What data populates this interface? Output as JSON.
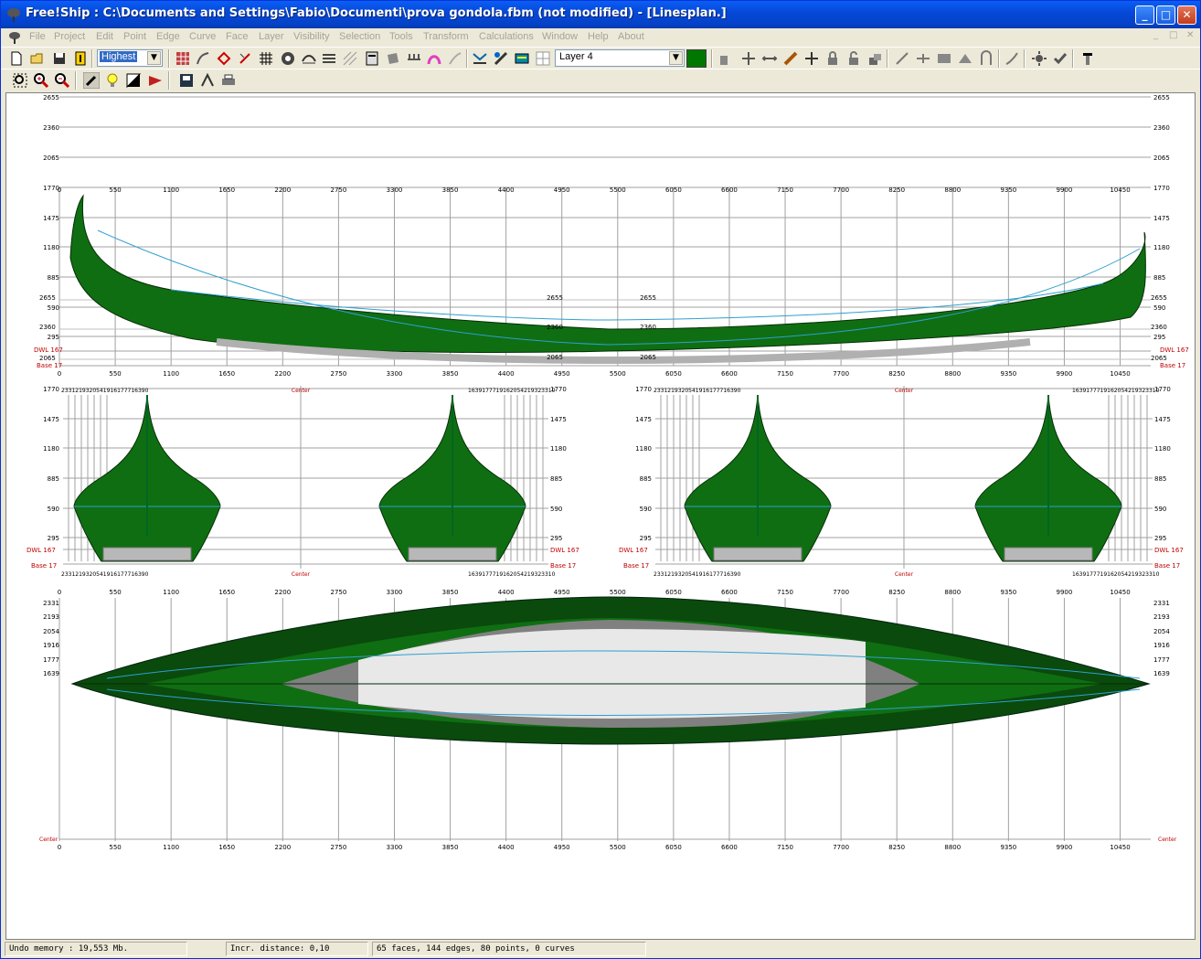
{
  "window": {
    "title": "Free!Ship  : C:\\Documents and Settings\\Fabio\\Documenti\\prova gondola.fbm (not modified) - [Linesplan.]",
    "minimize": "_",
    "maximize": "□",
    "close": "✕"
  },
  "menu": [
    "File",
    "Project",
    "Edit",
    "Point",
    "Edge",
    "Curve",
    "Face",
    "Layer",
    "Visibility",
    "Selection",
    "Tools",
    "Transform",
    "Calculations",
    "Window",
    "Help",
    "About"
  ],
  "mdi_controls": [
    "_",
    "□",
    "✕"
  ],
  "toolbar": {
    "precision_value": "Highest",
    "layer_value": "Layer 4",
    "layer_color": "#007800"
  },
  "colors": {
    "hull_green": "#0f6e12",
    "hull_dark": "#0a4a0c",
    "deck_light": "#e8e8e8",
    "grid": "#a0a0a0",
    "red_label": "#c00000"
  },
  "profile": {
    "y_ticks": [
      "2655",
      "2360",
      "2065",
      "1770",
      "1475",
      "1180",
      "885",
      "590",
      "295"
    ],
    "x_ticks": [
      "0",
      "550",
      "1100",
      "1650",
      "2200",
      "2750",
      "3300",
      "3850",
      "4400",
      "4950",
      "5500",
      "6050",
      "6600",
      "7150",
      "7700",
      "8250",
      "8800",
      "9350",
      "9900",
      "10450"
    ],
    "overlay_ticks": [
      "2655",
      "2360",
      "2065"
    ],
    "dwl": "DWL 167",
    "base": "Base 17",
    "base_left": "Base 17"
  },
  "bodyplan": {
    "y_ticks": [
      "1770",
      "1475",
      "1180",
      "885",
      "590",
      "295"
    ],
    "buttocks_left": "2331219320541916177716390",
    "buttocks_right": "1639177719162054219323310",
    "center": "Center",
    "dwl": "DWL 167",
    "base": "Base 17"
  },
  "plan": {
    "y_ticks": [
      "2331",
      "2193",
      "2054",
      "1916",
      "1777",
      "1639"
    ],
    "center": "Center"
  },
  "status": {
    "undo": "Undo memory : 19,553 Mb.",
    "incr": "Incr. distance: 0,10",
    "info": "65 faces, 144 edges, 80 points, 0 curves"
  }
}
